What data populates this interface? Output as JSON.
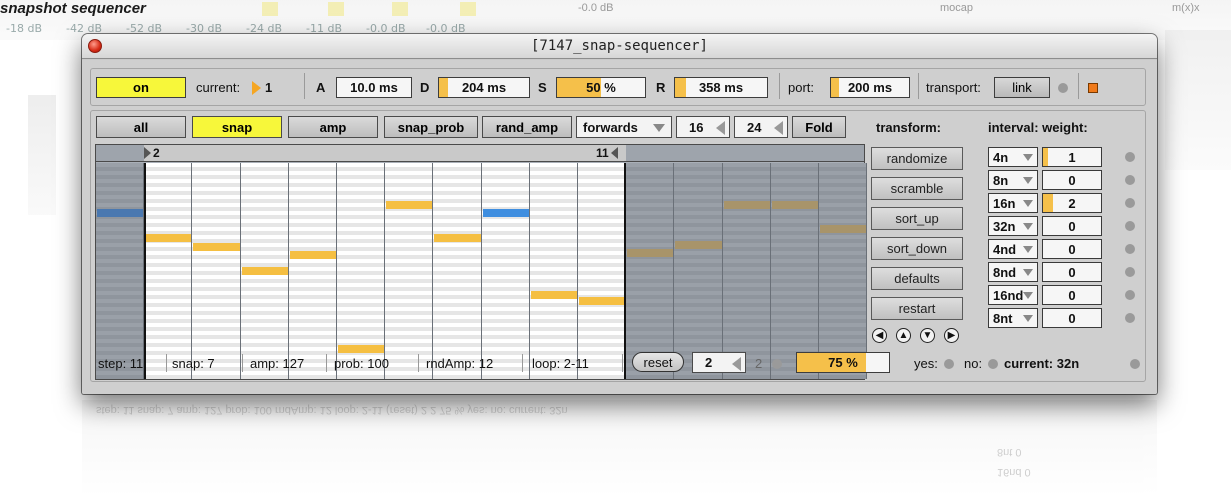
{
  "background": {
    "title": "snapshot sequencer",
    "db_readouts": [
      "-18 dB",
      "-42 dB",
      "-52 dB",
      "-30 dB",
      "-24 dB",
      "-11 dB",
      "-0.0 dB",
      "-0.0 dB"
    ],
    "top_labels": [
      "-0.0 dB",
      "mocap",
      "m(x)x"
    ]
  },
  "window": {
    "title": "[7147_snap-sequencer]"
  },
  "top_row": {
    "on_label": "on",
    "current_label": "current:",
    "current_value": "1",
    "a_label": "A",
    "a_value": "10.0 ms",
    "d_label": "D",
    "d_value": "204 ms",
    "d_fill": 0.1,
    "s_label": "S",
    "s_value": "50 %",
    "s_fill": 0.5,
    "r_label": "R",
    "r_value": "358 ms",
    "r_fill": 0.12,
    "port_label": "port:",
    "port_value": "200 ms",
    "port_fill": 0.1,
    "transport_label": "transport:",
    "link_label": "link"
  },
  "second_row": {
    "all_label": "all",
    "snap_label": "snap",
    "amp_label": "amp",
    "snap_prob_label": "snap_prob",
    "rand_amp_label": "rand_amp",
    "direction_value": "forwards",
    "steps_value": "16",
    "max_value": "24",
    "fold_label": "Fold"
  },
  "grid": {
    "loop_start_label": "2",
    "loop_end_label": "11",
    "note_colors": {
      "active": "#f5bf42",
      "inactive": "#a8946a",
      "current": "#3f8ee0",
      "inactive_current": "#4a78b0"
    }
  },
  "transform": {
    "header": "transform:",
    "buttons": [
      "randomize",
      "scramble",
      "sort_up",
      "sort_down",
      "defaults",
      "restart"
    ]
  },
  "intervals": {
    "header": "interval: weight:",
    "rows": [
      {
        "interval": "4n",
        "weight": "1",
        "fill": 0.08
      },
      {
        "interval": "8n",
        "weight": "0",
        "fill": 0
      },
      {
        "interval": "16n",
        "weight": "2",
        "fill": 0.18
      },
      {
        "interval": "32n",
        "weight": "0",
        "fill": 0
      },
      {
        "interval": "4nd",
        "weight": "0",
        "fill": 0
      },
      {
        "interval": "8nd",
        "weight": "0",
        "fill": 0
      },
      {
        "interval": "16nd",
        "weight": "0",
        "fill": 0
      },
      {
        "interval": "8nt",
        "weight": "0",
        "fill": 0
      }
    ]
  },
  "status": {
    "step": "step: 11",
    "snap": "snap: 7",
    "amp": "amp: 127",
    "prob": "prob: 100",
    "rndamp": "rndAmp: 12",
    "loop": "loop: 2-11",
    "reset_label": "reset",
    "count_value": "2",
    "count_readout": "2",
    "percent_value": "75 %",
    "percent_fill": 0.75,
    "yes_label": "yes:",
    "no_label": "no:",
    "current_label": "current: 32n"
  },
  "reflection": {
    "row1": "step: 11  snap: 7  amp: 127  prob: 100  rndAmp: 12  loop: 2-11  (reset)  2  2  75 %  yes: no: current: 32n",
    "row2": "8nt  0",
    "row3": "16nd  0"
  }
}
